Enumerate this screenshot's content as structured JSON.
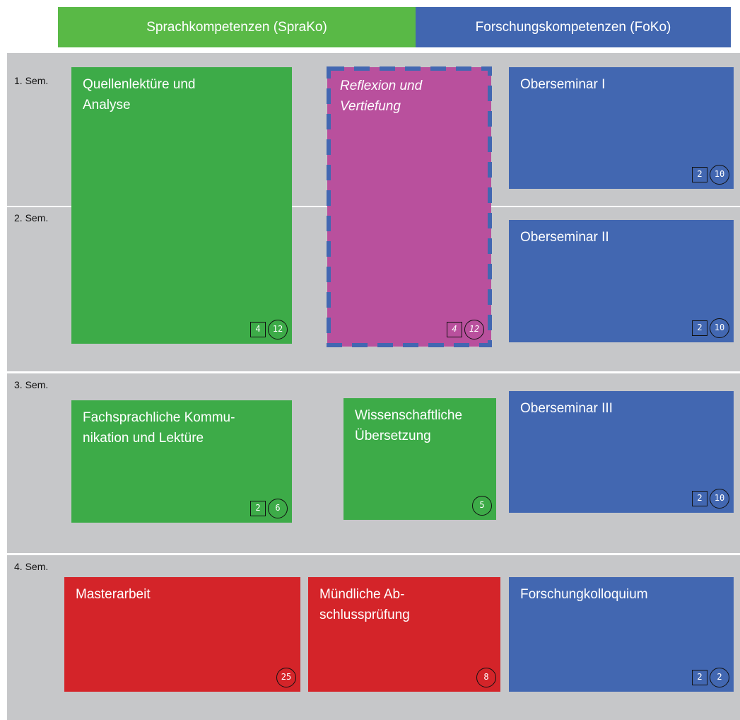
{
  "headers": {
    "sprako": "Sprachkompetenzen (SpraKo)",
    "foko": "Forschungskompetenzen (FoKo)"
  },
  "semesters": [
    "1. Sem.",
    "2. Sem.",
    "3. Sem.",
    "4. Sem."
  ],
  "modules": {
    "quellenlektuere": {
      "title": "Quellenlektüre und\nAnalyse",
      "sws": "4",
      "lp": "12"
    },
    "reflexion": {
      "title": "Reflexion und\nVertiefung",
      "sws": "4",
      "lp": "12"
    },
    "oberseminar1": {
      "title": "Oberseminar I",
      "sws": "2",
      "lp": "10"
    },
    "oberseminar2": {
      "title": "Oberseminar II",
      "sws": "2",
      "lp": "10"
    },
    "fachsprachliche": {
      "title": "Fachsprachliche Kommu-\nnikation und Lektüre",
      "sws": "2",
      "lp": "6"
    },
    "wissenschaftliche": {
      "title": "Wissenschaftliche\nÜbersetzung",
      "lp": "5"
    },
    "oberseminar3": {
      "title": "Oberseminar III",
      "sws": "2",
      "lp": "10"
    },
    "masterarbeit": {
      "title": "Masterarbeit",
      "lp": "25"
    },
    "muendliche": {
      "title": "Mündliche Ab-\nschlussprüfung",
      "lp": "8"
    },
    "forschungkolloquium": {
      "title": "Forschungkolloquium",
      "sws": "2",
      "lp": "2"
    }
  },
  "colors": {
    "sprako_header": "#59b946",
    "foko_header": "#4166b0",
    "sprako_module": "#3dab48",
    "foko_module": "#4267b1",
    "exam_module": "#d42429",
    "optional_module": "#b9509d",
    "band": "#c6c7c9"
  }
}
